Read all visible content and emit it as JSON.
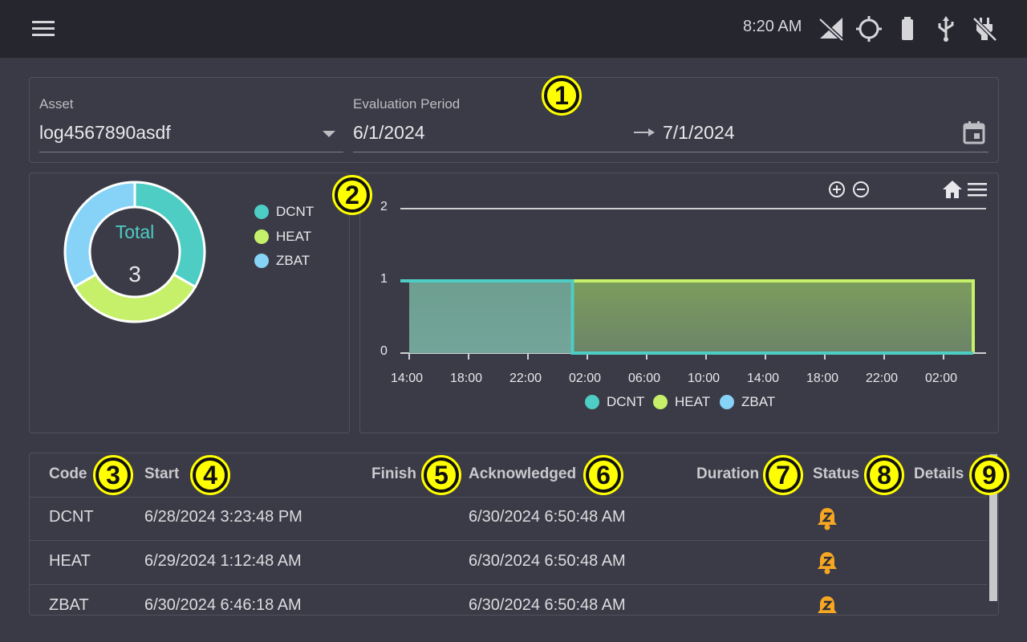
{
  "statusbar": {
    "time": "8:20 AM",
    "icons": [
      "no-signal-icon",
      "gps-icon",
      "battery-icon",
      "usb-icon",
      "no-power-icon"
    ]
  },
  "filter": {
    "asset_label": "Asset",
    "asset_value": "log4567890asdf",
    "period_label": "Evaluation Period",
    "period_start": "6/1/2024",
    "period_end": "7/1/2024"
  },
  "donut": {
    "title": "Total",
    "total": "3",
    "legend": [
      {
        "name": "DCNT",
        "color": "#4ecdc4"
      },
      {
        "name": "HEAT",
        "color": "#c6f06a"
      },
      {
        "name": "ZBAT",
        "color": "#86d3f7"
      }
    ]
  },
  "chart_data": {
    "type": "area",
    "y_ticks": [
      "2",
      "1",
      "0"
    ],
    "ylim": [
      0,
      2
    ],
    "x_ticks": [
      "14:00",
      "18:00",
      "22:00",
      "02:00",
      "06:00",
      "10:00",
      "14:00",
      "18:00",
      "22:00",
      "02:00"
    ],
    "series": [
      {
        "name": "DCNT",
        "color": "#4ecdc4",
        "segments": [
          {
            "from": "6/28/2024 14:00",
            "to": "6/29/2024 01:00",
            "value": 1
          }
        ]
      },
      {
        "name": "HEAT",
        "color": "#c6f06a",
        "segments": [
          {
            "from": "6/29/2024 01:00",
            "to": "6/30/2024 04:00",
            "value": 1
          }
        ]
      },
      {
        "name": "ZBAT",
        "color": "#86d3f7",
        "segments": []
      }
    ],
    "legend": [
      "DCNT",
      "HEAT",
      "ZBAT"
    ],
    "legend_position": "bottom"
  },
  "table": {
    "headers": {
      "code": "Code",
      "start": "Start",
      "finish": "Finish",
      "acknowledged": "Acknowledged",
      "duration": "Duration",
      "status": "Status",
      "details": "Details"
    },
    "rows": [
      {
        "code": "DCNT",
        "start": "6/28/2024 3:23:48 PM",
        "finish": "",
        "acknowledged": "6/30/2024 6:50:48 AM",
        "duration": "",
        "status_icon": "alarm-snooze-icon"
      },
      {
        "code": "HEAT",
        "start": "6/29/2024 1:12:48 AM",
        "finish": "",
        "acknowledged": "6/30/2024 6:50:48 AM",
        "duration": "",
        "status_icon": "alarm-snooze-icon"
      },
      {
        "code": "ZBAT",
        "start": "6/30/2024 6:46:18 AM",
        "finish": "",
        "acknowledged": "6/30/2024 6:50:48 AM",
        "duration": "",
        "status_icon": "alarm-snooze-icon"
      }
    ]
  },
  "annotations": [
    "1",
    "2",
    "3",
    "4",
    "5",
    "6",
    "7",
    "8",
    "9"
  ],
  "colors": {
    "accent": "#4ecdc4",
    "status_icon": "#f5a623",
    "annotation": "#ffff00"
  }
}
